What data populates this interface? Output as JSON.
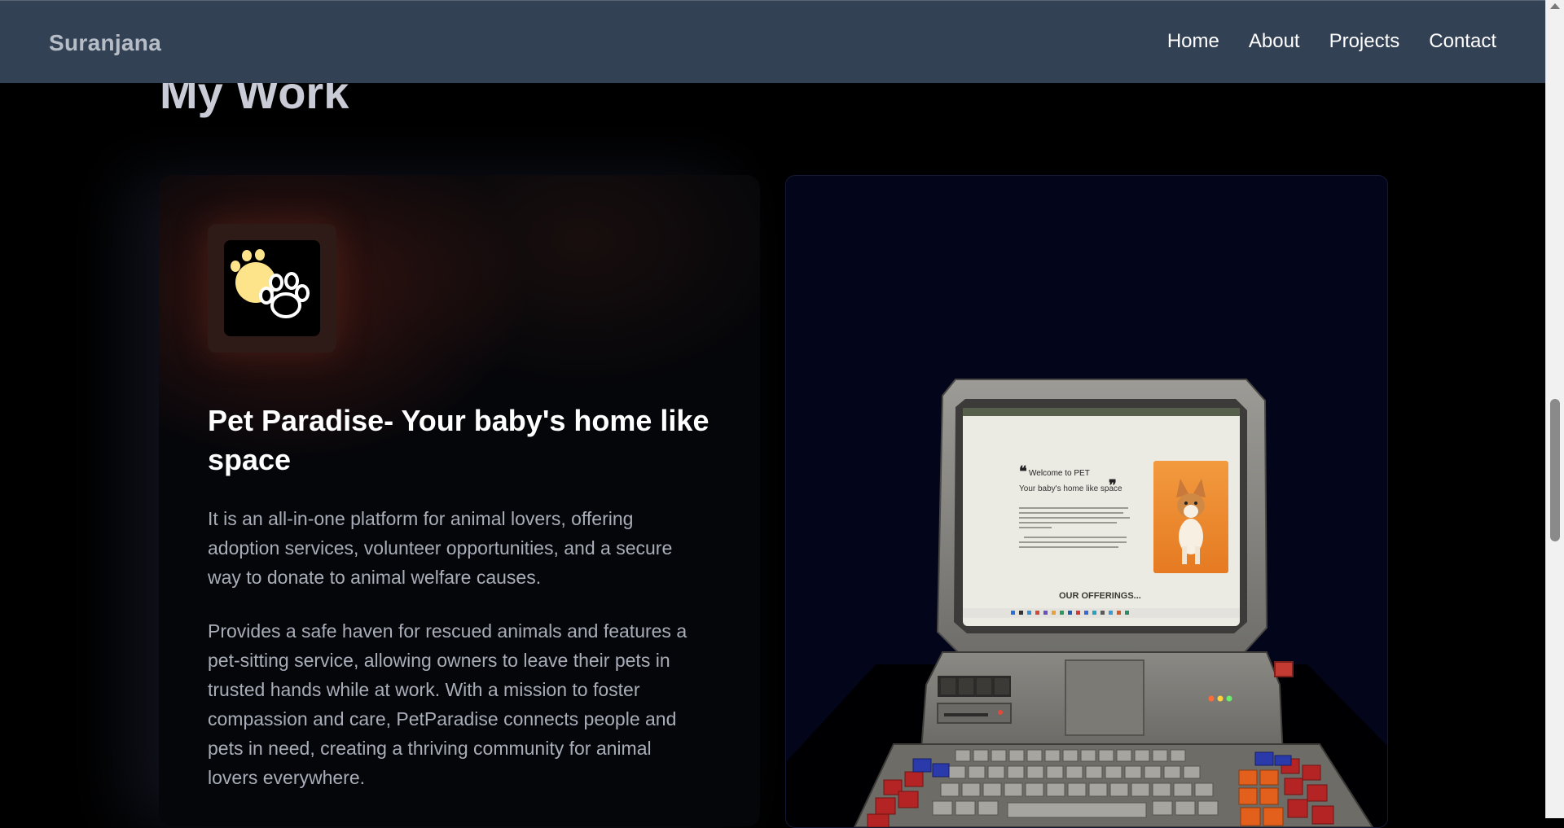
{
  "navbar": {
    "brand": "Suranjana",
    "links": [
      "Home",
      "About",
      "Projects",
      "Contact"
    ]
  },
  "section": {
    "title": "My Work"
  },
  "project": {
    "title": "Pet Paradise- Your baby's home like space",
    "description_1": "It is an all-in-one platform for animal lovers, offering adoption services, volunteer opportunities, and a secure way to donate to animal welfare causes.",
    "description_2": "Provides a safe haven for rescued animals and features a pet-sitting service, allowing owners to leave their pets in trusted hands while at work. With a mission to foster compassion and care, PetParadise connects people and pets in need, creating a thriving community for animal lovers everywhere.",
    "logo_icon": "paw-icon"
  },
  "preview": {
    "screen_heading": "Welcome to PET",
    "screen_subheading": "Your baby's home like space",
    "screen_section_label": "OUR OFFERINGS..."
  },
  "colors": {
    "navbar_bg": "#334155",
    "page_bg": "#000000",
    "paw_yellow": "#fde48a",
    "accent_orange": "#f08a2c"
  }
}
